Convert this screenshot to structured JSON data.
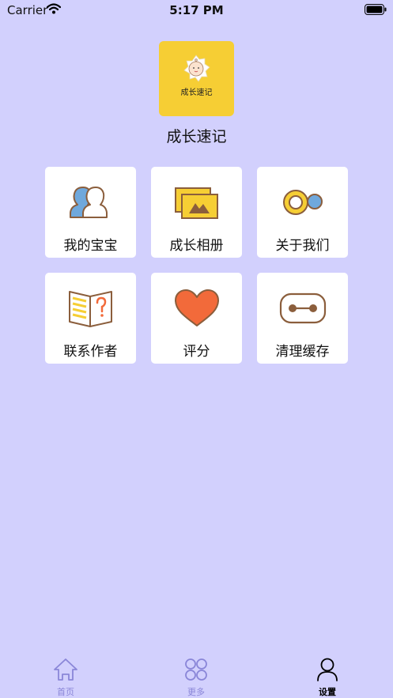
{
  "status_bar": {
    "carrier": "Carrier",
    "time": "5:17 PM"
  },
  "app": {
    "logo_text": "成长速记",
    "name": "成长速记"
  },
  "menu": {
    "items": [
      {
        "label": "我的宝宝",
        "icon": "users-icon"
      },
      {
        "label": "成长相册",
        "icon": "photo-album-icon"
      },
      {
        "label": "关于我们",
        "icon": "toggle-icon"
      },
      {
        "label": "联系作者",
        "icon": "book-question-icon"
      },
      {
        "label": "评分",
        "icon": "heart-icon"
      },
      {
        "label": "清理缓存",
        "icon": "clear-cache-icon"
      }
    ]
  },
  "tab_bar": {
    "tabs": [
      {
        "label": "首页",
        "icon": "home-icon",
        "active": false
      },
      {
        "label": "更多",
        "icon": "grid-icon",
        "active": false
      },
      {
        "label": "设置",
        "icon": "person-icon",
        "active": true
      }
    ]
  },
  "colors": {
    "background": "#d2d0fd",
    "logo_bg": "#f6ce34",
    "tab_inactive": "#8a86d8",
    "tab_active": "#000000",
    "icon_brown": "#8b5e3c",
    "icon_yellow": "#f6ce34",
    "icon_blue": "#6fa8dc",
    "icon_orange": "#f26a3a"
  }
}
